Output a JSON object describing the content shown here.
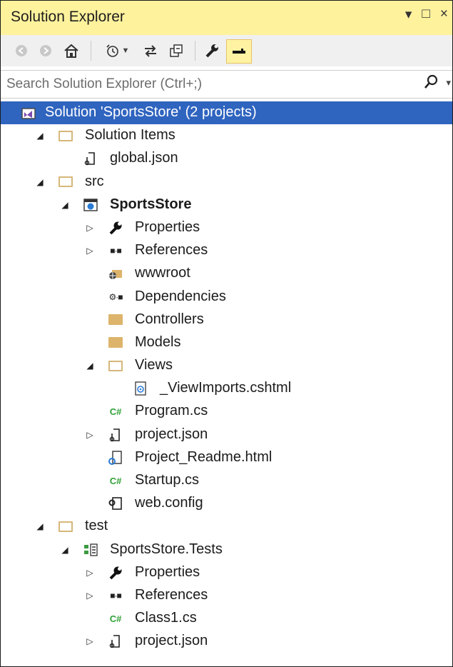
{
  "window": {
    "title": "Solution Explorer",
    "controls": [
      "▾",
      "□",
      "×"
    ]
  },
  "toolbar": {
    "buttons": [
      {
        "name": "back",
        "icon": "back-icon",
        "glyph": "◯",
        "enabled": false
      },
      {
        "name": "forward",
        "icon": "forward-icon",
        "glyph": "◯",
        "enabled": false
      },
      {
        "name": "home",
        "icon": "home-icon",
        "glyph": "⌂",
        "enabled": true
      },
      {
        "name": "pending-changes",
        "icon": "history-icon",
        "glyph": "⏲▾",
        "enabled": true
      },
      {
        "name": "sync",
        "icon": "sync-icon",
        "glyph": "⇆",
        "enabled": true
      },
      {
        "name": "collapse-all",
        "icon": "collapse-all-icon",
        "glyph": "⧉",
        "enabled": true
      },
      {
        "name": "properties",
        "icon": "wrench-icon",
        "glyph": "🔧",
        "enabled": true
      },
      {
        "name": "preview",
        "icon": "preview-icon",
        "glyph": "▬",
        "enabled": true,
        "active": true
      }
    ]
  },
  "search": {
    "placeholder": "Search Solution Explorer (Ctrl+;)",
    "value": "",
    "icon": "search-icon"
  },
  "tree": [
    {
      "label": "Solution 'SportsStore' (2 projects)",
      "level": 0,
      "icon": "solution-icon",
      "expander": "none",
      "selected": true
    },
    {
      "label": "Solution Items",
      "level": 1,
      "icon": "folder-open-icon",
      "expander": "expanded"
    },
    {
      "label": "global.json",
      "level": 2,
      "icon": "json-file-icon",
      "expander": "none"
    },
    {
      "label": "src",
      "level": 1,
      "icon": "folder-open-icon",
      "expander": "expanded"
    },
    {
      "label": "SportsStore",
      "level": 2,
      "icon": "web-project-icon",
      "expander": "expanded",
      "bold": true
    },
    {
      "label": "Properties",
      "level": 3,
      "icon": "wrench-icon",
      "expander": "collapsed"
    },
    {
      "label": "References",
      "level": 3,
      "icon": "references-icon",
      "expander": "collapsed"
    },
    {
      "label": "wwwroot",
      "level": 3,
      "icon": "globe-folder-icon",
      "expander": "none"
    },
    {
      "label": "Dependencies",
      "level": 3,
      "icon": "dependencies-icon",
      "expander": "none"
    },
    {
      "label": "Controllers",
      "level": 3,
      "icon": "folder-icon",
      "expander": "none"
    },
    {
      "label": "Models",
      "level": 3,
      "icon": "folder-icon",
      "expander": "none"
    },
    {
      "label": "Views",
      "level": 3,
      "icon": "folder-open-icon",
      "expander": "expanded"
    },
    {
      "label": "_ViewImports.cshtml",
      "level": 4,
      "icon": "cshtml-file-icon",
      "expander": "none"
    },
    {
      "label": "Program.cs",
      "level": 3,
      "icon": "csharp-file-icon",
      "expander": "none"
    },
    {
      "label": "project.json",
      "level": 3,
      "icon": "json-file-icon",
      "expander": "collapsed"
    },
    {
      "label": "Project_Readme.html",
      "level": 3,
      "icon": "html-file-icon",
      "expander": "none"
    },
    {
      "label": "Startup.cs",
      "level": 3,
      "icon": "csharp-file-icon",
      "expander": "none"
    },
    {
      "label": "web.config",
      "level": 3,
      "icon": "config-file-icon",
      "expander": "none"
    },
    {
      "label": "test",
      "level": 1,
      "icon": "folder-open-icon",
      "expander": "expanded"
    },
    {
      "label": "SportsStore.Tests",
      "level": 2,
      "icon": "test-project-icon",
      "expander": "expanded"
    },
    {
      "label": "Properties",
      "level": 3,
      "icon": "wrench-icon",
      "expander": "collapsed"
    },
    {
      "label": "References",
      "level": 3,
      "icon": "references-icon",
      "expander": "collapsed"
    },
    {
      "label": "Class1.cs",
      "level": 3,
      "icon": "csharp-file-icon",
      "expander": "none"
    },
    {
      "label": "project.json",
      "level": 3,
      "icon": "json-file-icon",
      "expander": "collapsed"
    }
  ]
}
